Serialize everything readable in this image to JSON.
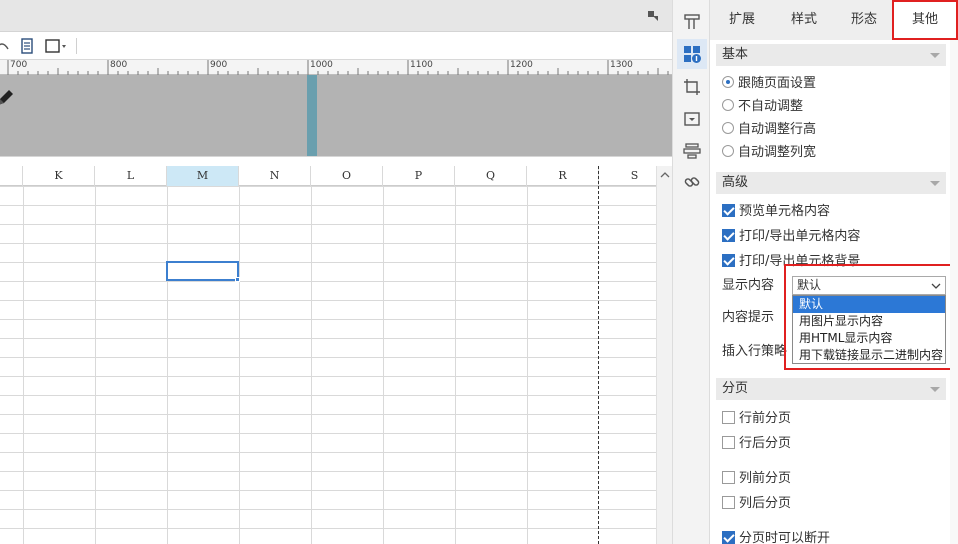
{
  "ruler": {
    "labels": [
      "700",
      "800",
      "900",
      "1000",
      "1100",
      "1200",
      "1300"
    ]
  },
  "grid": {
    "columns": [
      "K",
      "L",
      "M",
      "N",
      "O",
      "P",
      "Q",
      "R",
      "S"
    ],
    "selected_column": "M"
  },
  "panel": {
    "tabs": [
      "扩展",
      "样式",
      "形态",
      "其他"
    ],
    "active_tab": "其他",
    "basic": {
      "title": "基本",
      "options": [
        "跟随页面设置",
        "不自动调整",
        "自动调整行高",
        "自动调整列宽"
      ],
      "selected": "跟随页面设置"
    },
    "advanced": {
      "title": "高级",
      "checks": [
        {
          "label": "预览单元格内容",
          "checked": true
        },
        {
          "label": "打印/导出单元格内容",
          "checked": true
        },
        {
          "label": "打印/导出单元格背景",
          "checked": true
        }
      ],
      "display_label": "显示内容",
      "display_value": "默认",
      "display_options": [
        "默认",
        "用图片显示内容",
        "用HTML显示内容",
        "用下载链接显示二进制内容"
      ],
      "tooltip_label": "内容提示",
      "insert_label": "插入行策略"
    },
    "paging": {
      "title": "分页",
      "checks": [
        {
          "label": "行前分页",
          "checked": false
        },
        {
          "label": "行后分页",
          "checked": false
        },
        {
          "label": "列前分页",
          "checked": false
        },
        {
          "label": "列后分页",
          "checked": false
        },
        {
          "label": "分页时可以断开",
          "checked": true
        }
      ]
    }
  },
  "colors": {
    "accent": "#2c78d6",
    "highlight_box": "#e02020",
    "selected_column_bg": "#cde8f6"
  },
  "icons": {
    "strip": [
      "layout-icon",
      "cell-attributes-icon",
      "crop-icon",
      "dropdown-widget-icon",
      "stack-icon",
      "link-icon"
    ]
  }
}
